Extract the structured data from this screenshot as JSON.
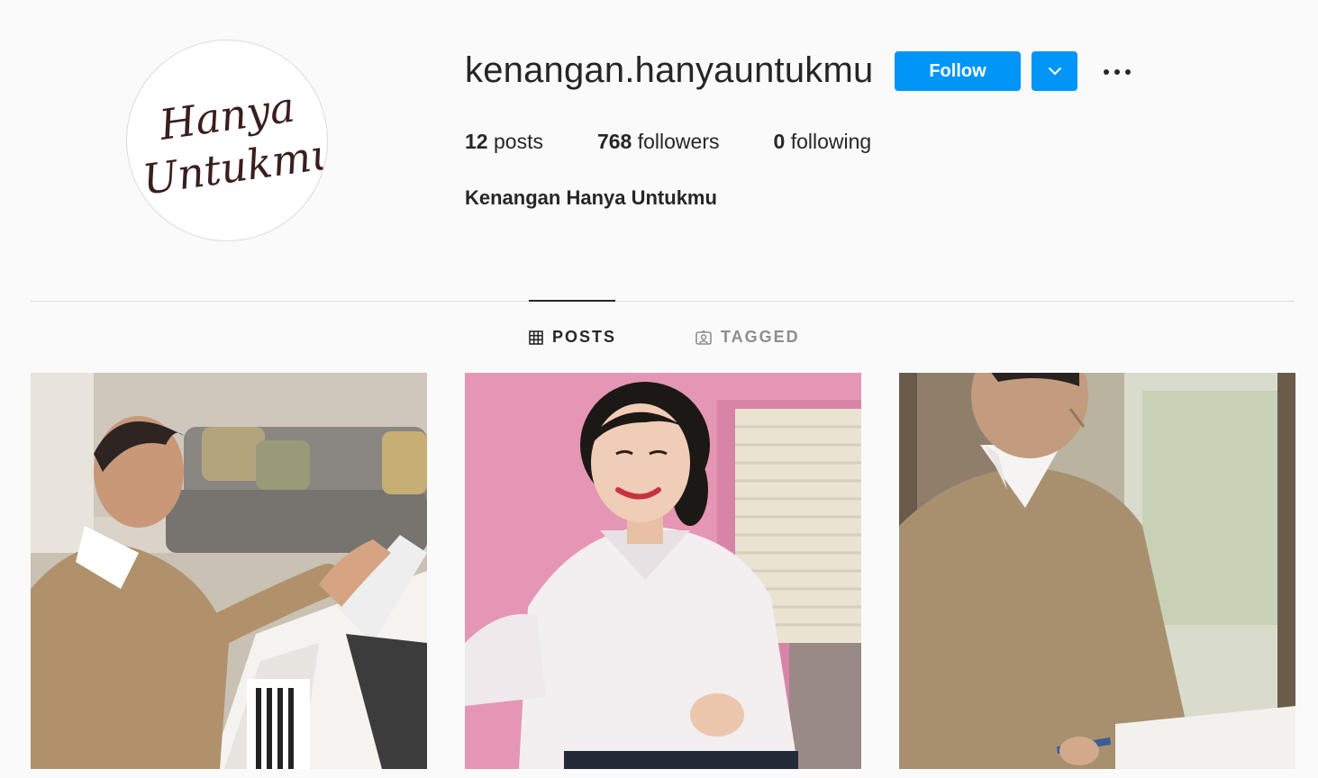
{
  "profile": {
    "avatar_text_line1": "Hanya",
    "avatar_text_line2": "Untukmu",
    "username": "kenangan.hanyauntukmu",
    "full_name": "Kenangan Hanya Untukmu"
  },
  "actions": {
    "follow_label": "Follow",
    "dropdown_icon": "chevron-down-icon",
    "more_icon": "more-options-icon"
  },
  "stats": {
    "posts_count": "12",
    "posts_label": "posts",
    "followers_count": "768",
    "followers_label": "followers",
    "following_count": "0",
    "following_label": "following"
  },
  "tabs": [
    {
      "label": "POSTS",
      "icon": "grid-icon",
      "active": true
    },
    {
      "label": "TAGGED",
      "icon": "tagged-icon",
      "active": false
    }
  ],
  "posts": [
    {
      "description": "man-at-piano-photo"
    },
    {
      "description": "woman-in-white-shirt-photo"
    },
    {
      "description": "man-reading-photo"
    }
  ],
  "colors": {
    "accent": "#0095f6",
    "background": "#fafafa",
    "text": "#262626",
    "muted": "#8e8e8e"
  }
}
